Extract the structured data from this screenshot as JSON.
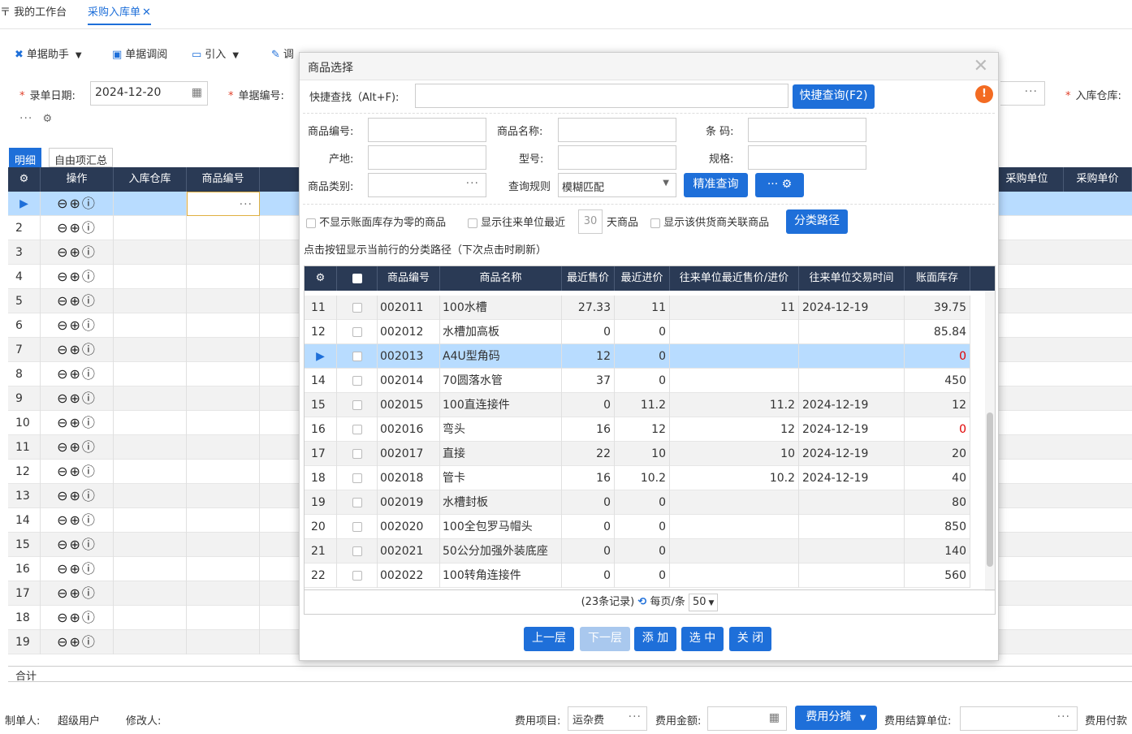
{
  "tabs": [
    {
      "label": "我的工作台"
    },
    {
      "label": "采购入库单"
    }
  ],
  "toolbar": [
    {
      "icon": "magic-icon",
      "label": "单据助手"
    },
    {
      "icon": "doc-review-icon",
      "label": "单据调阅"
    },
    {
      "icon": "import-icon",
      "label": "引入"
    },
    {
      "icon": "adjust-icon",
      "label": "调"
    }
  ],
  "form": {
    "date_label": "录单日期:",
    "date_value": "2024-12-20",
    "no_label": "单据编号:",
    "warehouse_label": "入库仓库:"
  },
  "subtabs": [
    "明细",
    "自由项汇总"
  ],
  "grid": {
    "headers": [
      "操作",
      "入库仓库",
      "商品编号",
      "采购单位",
      "采购单价"
    ],
    "rows": [
      "2",
      "3",
      "4",
      "5",
      "6",
      "7",
      "8",
      "9",
      "10",
      "11",
      "12",
      "13",
      "14",
      "15",
      "16",
      "17",
      "18",
      "19"
    ],
    "sum_label": "合计"
  },
  "footer": {
    "maker_label": "制单人:",
    "maker_value": "超级用户",
    "modifier_label": "修改人:",
    "fee_item_label": "费用项目:",
    "fee_item_value": "运杂费",
    "fee_amount_label": "费用金额:",
    "fee_split_btn": "费用分摊",
    "fee_unit_label": "费用结算单位:",
    "fee_pay_label": "费用付款"
  },
  "dialog": {
    "title": "商品选择",
    "quick_label": "快捷查找（Alt+F):",
    "quick_btn": "快捷查询(F2)",
    "code_label": "商品编号:",
    "name_label": "商品名称:",
    "barcode_label": "条 码:",
    "origin_label": "产地:",
    "model_label": "型号:",
    "spec_label": "规格:",
    "category_label": "商品类别:",
    "rule_label": "查询规则",
    "rule_value": "模糊匹配",
    "exact_btn": "精准查询",
    "opt1": "不显示账面库存为零的商品",
    "opt2_a": "显示往来单位最近",
    "opt2_days": "30",
    "opt2_b": "天商品",
    "opt3": "显示该供货商关联商品",
    "path_btn": "分类路径",
    "hint": "点击按钮显示当前行的分类路径（下次点击时刷新）",
    "headers": [
      "商品编号",
      "商品名称",
      "最近售价",
      "最近进价",
      "往来单位最近售价/进价",
      "往来单位交易时间",
      "账面库存"
    ],
    "rows": [
      {
        "no": "11",
        "code": "002011",
        "name": "100水槽",
        "sale": "27.33",
        "buy": "11",
        "unit_price": "11",
        "time": "2024-12-19",
        "stock": "39.75"
      },
      {
        "no": "12",
        "code": "002012",
        "name": "水槽加高板",
        "sale": "0",
        "buy": "0",
        "unit_price": "",
        "time": "",
        "stock": "85.84"
      },
      {
        "no": "",
        "code": "002013",
        "name": "A4U型角码",
        "sale": "12",
        "buy": "0",
        "unit_price": "",
        "time": "",
        "stock": "0"
      },
      {
        "no": "14",
        "code": "002014",
        "name": "70圆落水管",
        "sale": "37",
        "buy": "0",
        "unit_price": "",
        "time": "",
        "stock": "450"
      },
      {
        "no": "15",
        "code": "002015",
        "name": "100直连接件",
        "sale": "0",
        "buy": "11.2",
        "unit_price": "11.2",
        "time": "2024-12-19",
        "stock": "12"
      },
      {
        "no": "16",
        "code": "002016",
        "name": "弯头",
        "sale": "16",
        "buy": "12",
        "unit_price": "12",
        "time": "2024-12-19",
        "stock": "0"
      },
      {
        "no": "17",
        "code": "002017",
        "name": "直接",
        "sale": "22",
        "buy": "10",
        "unit_price": "10",
        "time": "2024-12-19",
        "stock": "20"
      },
      {
        "no": "18",
        "code": "002018",
        "name": "管卡",
        "sale": "16",
        "buy": "10.2",
        "unit_price": "10.2",
        "time": "2024-12-19",
        "stock": "40"
      },
      {
        "no": "19",
        "code": "002019",
        "name": "水槽封板",
        "sale": "0",
        "buy": "0",
        "unit_price": "",
        "time": "",
        "stock": "80"
      },
      {
        "no": "20",
        "code": "002020",
        "name": "100全包罗马帽头",
        "sale": "0",
        "buy": "0",
        "unit_price": "",
        "time": "",
        "stock": "850"
      },
      {
        "no": "21",
        "code": "002021",
        "name": "50公分加强外装底座",
        "sale": "0",
        "buy": "0",
        "unit_price": "",
        "time": "",
        "stock": "140"
      },
      {
        "no": "22",
        "code": "002022",
        "name": "100转角连接件",
        "sale": "0",
        "buy": "0",
        "unit_price": "",
        "time": "",
        "stock": "560"
      }
    ],
    "pager_count": "(23条记录)",
    "pager_per": "每页/条",
    "pager_size": "50",
    "btn_up": "上一层",
    "btn_down": "下一层",
    "btn_add": "添 加",
    "btn_select": "选 中",
    "btn_close": "关 闭"
  }
}
